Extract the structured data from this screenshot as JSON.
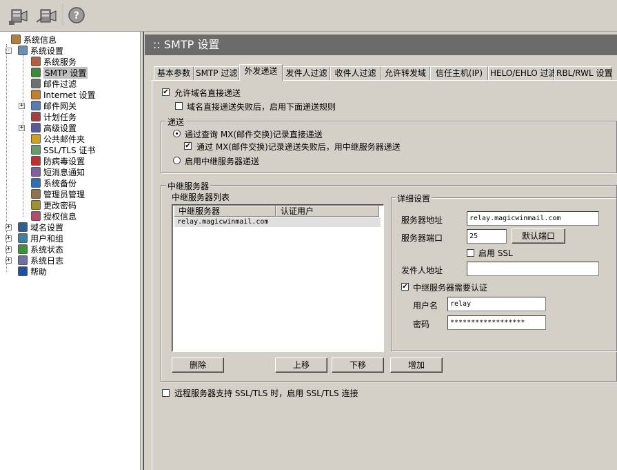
{
  "toolbar": {
    "buttons": [
      {
        "icon": "connect-server-icon"
      },
      {
        "icon": "disconnect-server-icon"
      },
      {
        "icon": "help-icon",
        "glyph": "?"
      }
    ]
  },
  "tree": {
    "items": [
      {
        "label": "系统信息",
        "icon": "info-icon"
      },
      {
        "label": "系统设置",
        "icon": "settings-icon",
        "expander": "-"
      },
      {
        "label": "系统服务",
        "icon": "service-icon"
      },
      {
        "label": "SMTP 设置",
        "icon": "smtp-icon",
        "selected": true
      },
      {
        "label": "邮件过滤",
        "icon": "filter-icon"
      },
      {
        "label": "Internet 设置",
        "icon": "internet-icon"
      },
      {
        "label": "邮件网关",
        "icon": "gateway-icon",
        "expander": "+"
      },
      {
        "label": "计划任务",
        "icon": "task-icon"
      },
      {
        "label": "高级设置",
        "icon": "advanced-icon",
        "expander": "+"
      },
      {
        "label": "公共邮件夹",
        "icon": "folder-icon"
      },
      {
        "label": "SSL/TLS 证书",
        "icon": "certificate-icon"
      },
      {
        "label": "防病毒设置",
        "icon": "antivirus-icon"
      },
      {
        "label": "短消息通知",
        "icon": "sms-icon"
      },
      {
        "label": "系统备份",
        "icon": "backup-icon"
      },
      {
        "label": "管理员管理",
        "icon": "admin-icon"
      },
      {
        "label": "更改密码",
        "icon": "key-icon"
      },
      {
        "label": "授权信息",
        "icon": "license-icon"
      },
      {
        "label": "域名设置",
        "icon": "domain-icon",
        "expander": "+"
      },
      {
        "label": "用户和组",
        "icon": "users-icon",
        "expander": "+"
      },
      {
        "label": "系统状态",
        "icon": "status-icon",
        "expander": "+"
      },
      {
        "label": "系统日志",
        "icon": "log-icon",
        "expander": "+"
      },
      {
        "label": "帮助",
        "icon": "help-book-icon"
      }
    ]
  },
  "main": {
    "title": ":: SMTP 设置",
    "tabs": [
      {
        "label": "基本参数"
      },
      {
        "label": "SMTP 过滤"
      },
      {
        "label": "外发递送",
        "active": true
      },
      {
        "label": "发件人过滤"
      },
      {
        "label": "收件人过滤"
      },
      {
        "label": "允许转发域"
      },
      {
        "label": "信任主机(IP)"
      },
      {
        "label": "HELO/EHLO 过滤"
      },
      {
        "label": "RBL/RWL 设置"
      }
    ],
    "allow_direct": {
      "label": "允许域名直接递送",
      "checked": true
    },
    "fallback_rules": {
      "label": "域名直接递送失败后，启用下面递送规则",
      "checked": false
    },
    "delivery": {
      "title": "递送",
      "mx_option": {
        "label": "通过查询 MX(邮件交换)记录直接递送",
        "selected": true
      },
      "mx_fallback": {
        "label": "通过 MX(邮件交换)记录递送失败后，用中继服务器递送",
        "checked": true
      },
      "relay_option": {
        "label": "启用中继服务器递送",
        "selected": false
      }
    },
    "relay": {
      "title": "中继服务器",
      "list_title": "中继服务器列表",
      "columns": [
        "中继服务器",
        "认证用户"
      ],
      "rows": [
        [
          "relay.magicwinmail.com",
          ""
        ]
      ],
      "buttons": {
        "delete": "删除",
        "up": "上移",
        "down": "下移",
        "add": "增加"
      }
    },
    "details": {
      "title": "详细设置",
      "server_label": "服务器地址",
      "server_value": "relay.magicwinmail.com",
      "port_label": "服务器端口",
      "port_value": "25",
      "default_port": "默认端口",
      "ssl": {
        "label": "启用 SSL",
        "checked": false
      },
      "sender_label": "发件人地址",
      "sender_value": "",
      "auth": {
        "label": "中继服务器需要认证",
        "checked": true
      },
      "user_label": "用户名",
      "user_value": "relay",
      "pass_label": "密码",
      "pass_value": "******************"
    },
    "remote_ssl": {
      "label": "远程服务器支持 SSL/TLS 时，启用 SSL/TLS 连接",
      "checked": false
    }
  }
}
